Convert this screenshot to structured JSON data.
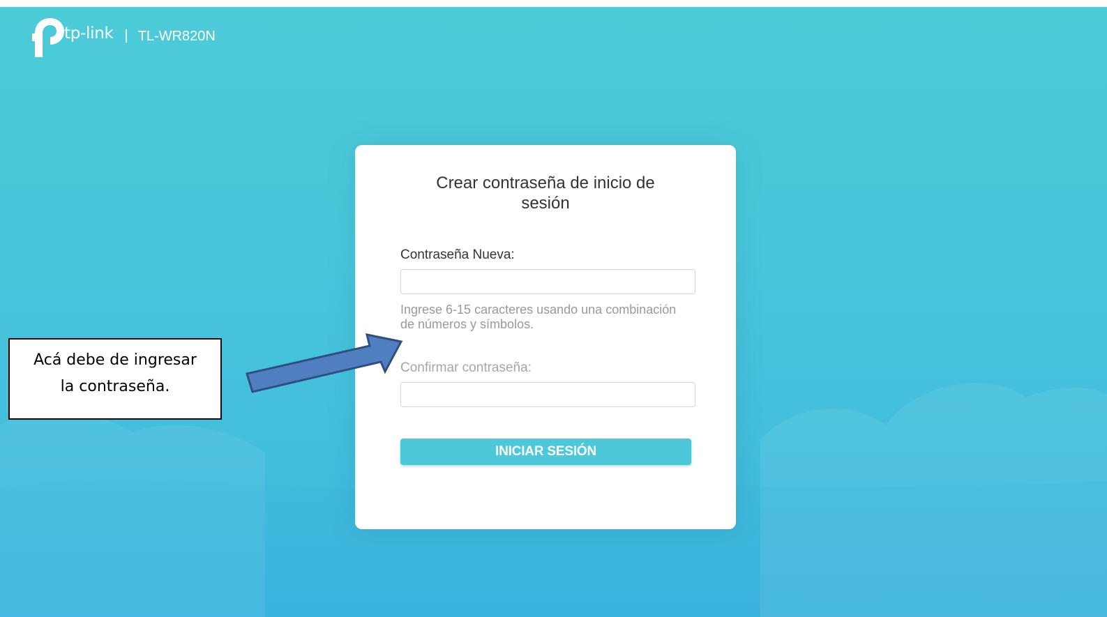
{
  "header": {
    "brand": "tp-link",
    "separator": "|",
    "model": "TL-WR820N"
  },
  "card": {
    "title": "Crear contraseña de inicio de sesión",
    "new_password_label": "Contraseña Nueva:",
    "new_password_value": "",
    "hint": "Ingrese 6-15 caracteres usando una combinación de números y símbolos.",
    "confirm_password_label": "Confirmar contraseña:",
    "confirm_password_value": "",
    "login_button": "INICIAR SESIÓN"
  },
  "annotation": {
    "line1": "Acá debe de ingresar",
    "line2": "la contraseña."
  },
  "colors": {
    "background": "#48c6da",
    "button": "#4cc8d8",
    "arrow_fill": "#4f7fc0",
    "arrow_stroke": "#2f4f7f"
  },
  "icons": {
    "logo": "tp-link-logo-icon",
    "arrow": "callout-arrow-icon"
  }
}
